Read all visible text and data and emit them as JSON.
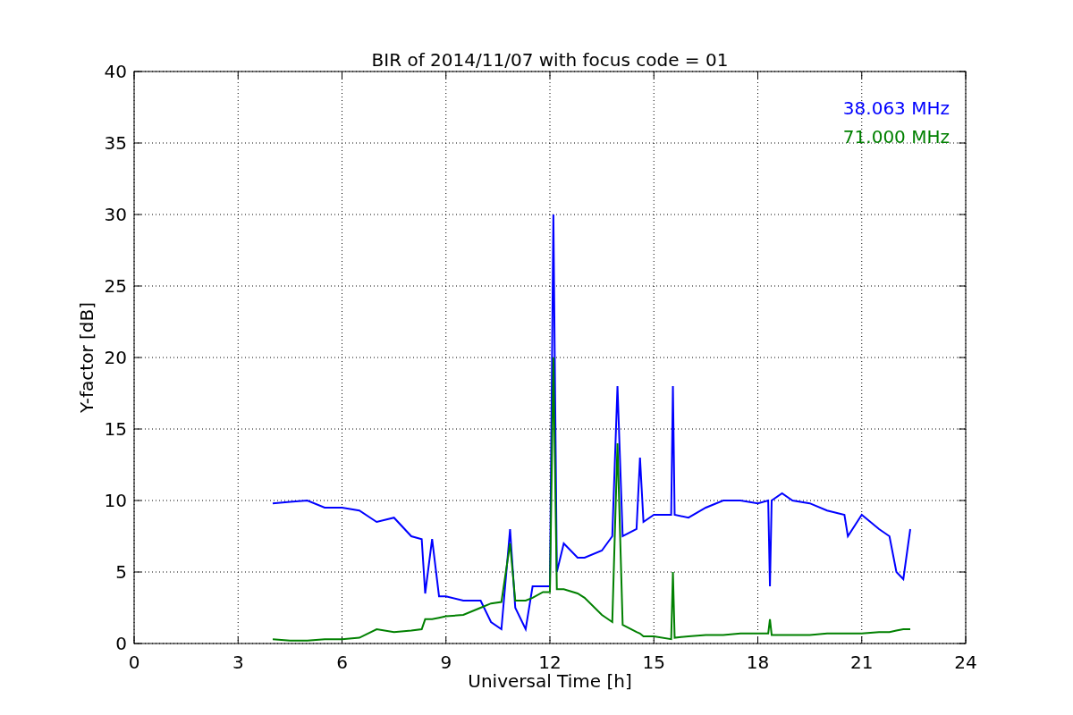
{
  "figure": {
    "chart_data": {
      "type": "line",
      "title": "BIR of 2014/11/07 with focus code = 01",
      "xlabel": "Universal Time [h]",
      "ylabel": "Y-factor [dB]",
      "x": [
        4,
        4.5,
        5,
        5.5,
        6,
        6.5,
        7,
        7.5,
        8,
        8.3,
        8.4,
        8.6,
        8.8,
        9,
        9.5,
        10,
        10.3,
        10.6,
        10.85,
        11,
        11.3,
        11.5,
        11.8,
        12,
        12.1,
        12.2,
        12.4,
        12.8,
        13,
        13.5,
        13.8,
        13.95,
        14.1,
        14.5,
        14.6,
        14.7,
        15,
        15.5,
        15.55,
        15.6,
        16,
        16.5,
        17,
        17.5,
        18,
        18.3,
        18.35,
        18.4,
        18.7,
        19,
        19.5,
        20,
        20.5,
        20.6,
        21,
        21.5,
        21.8,
        22,
        22.2,
        22.4
      ],
      "series": [
        {
          "name": "38.063 MHz",
          "color": "#0000ff",
          "values": [
            9.8,
            9.9,
            10,
            9.5,
            9.5,
            9.3,
            8.5,
            8.8,
            7.5,
            7.3,
            3.5,
            7.3,
            3.3,
            3.3,
            3,
            3,
            1.5,
            1,
            8,
            2.5,
            1,
            4,
            4,
            4,
            30,
            5,
            7,
            6,
            6,
            6.5,
            7.5,
            18,
            7.5,
            8,
            13,
            8.5,
            9,
            9,
            18,
            9,
            8.8,
            9.5,
            10,
            10,
            9.8,
            10,
            4,
            10,
            10.5,
            10,
            9.8,
            9.3,
            9,
            7.5,
            9,
            8,
            7.5,
            5,
            4.5,
            8
          ]
        },
        {
          "name": "71.000 MHz",
          "color": "#008000",
          "values": [
            0.3,
            0.2,
            0.2,
            0.3,
            0.3,
            0.4,
            1,
            0.8,
            0.9,
            1,
            1.7,
            1.7,
            1.8,
            1.9,
            2,
            2.5,
            2.8,
            2.9,
            7,
            3,
            3,
            3.2,
            3.6,
            3.6,
            20,
            3.8,
            3.8,
            3.5,
            3.2,
            2,
            1.5,
            14,
            1.3,
            0.8,
            0.7,
            0.5,
            0.5,
            0.3,
            5,
            0.4,
            0.5,
            0.6,
            0.6,
            0.7,
            0.7,
            0.7,
            1.7,
            0.6,
            0.6,
            0.6,
            0.6,
            0.7,
            0.7,
            0.7,
            0.7,
            0.8,
            0.8,
            0.9,
            1,
            1
          ]
        }
      ],
      "grid": true,
      "xlim": [
        0,
        24
      ],
      "ylim": [
        0,
        40
      ],
      "xticks": [
        0,
        3,
        6,
        9,
        12,
        15,
        18,
        21,
        24
      ],
      "yticks": [
        0,
        5,
        10,
        15,
        20,
        25,
        30,
        35,
        40
      ]
    }
  }
}
